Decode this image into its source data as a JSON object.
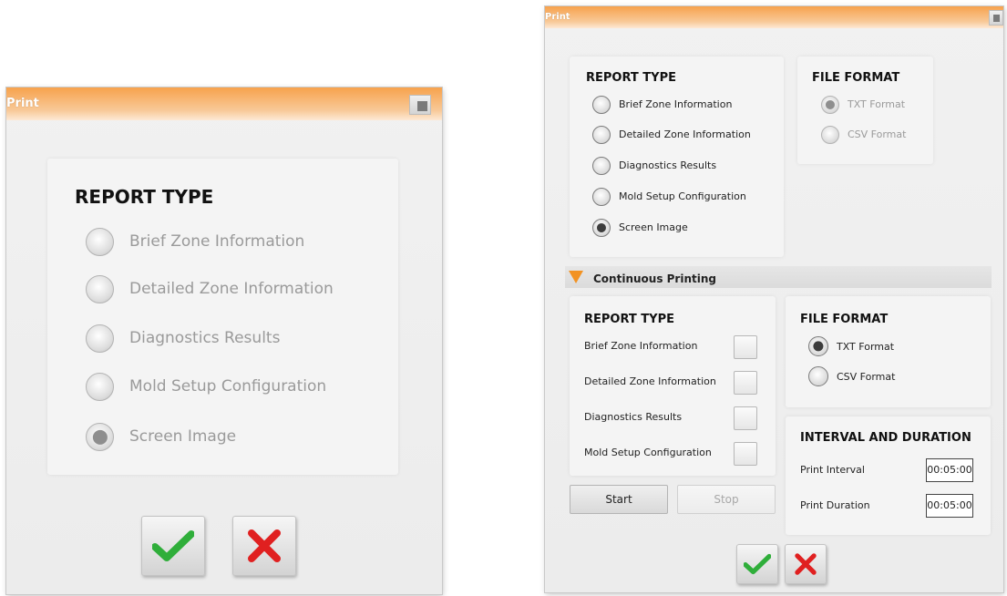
{
  "left_dialog": {
    "title": "Print",
    "report_type": {
      "heading": "REPORT TYPE",
      "options": [
        {
          "label": "Brief Zone Information",
          "selected": false
        },
        {
          "label": "Detailed Zone Information",
          "selected": false
        },
        {
          "label": "Diagnostics Results",
          "selected": false
        },
        {
          "label": "Mold Setup Configuration",
          "selected": false
        },
        {
          "label": "Screen Image",
          "selected": true
        }
      ]
    },
    "ok_icon": "checkmark-icon",
    "cancel_icon": "close-x-icon"
  },
  "right_dialog": {
    "title": "Print",
    "report_type": {
      "heading": "REPORT TYPE",
      "options": [
        {
          "label": "Brief Zone Information",
          "selected": false
        },
        {
          "label": "Detailed Zone Information",
          "selected": false
        },
        {
          "label": "Diagnostics Results",
          "selected": false
        },
        {
          "label": "Mold Setup Configuration",
          "selected": false
        },
        {
          "label": "Screen Image",
          "selected": true
        }
      ]
    },
    "file_format": {
      "heading": "FILE FORMAT",
      "options": [
        {
          "label": "TXT Format",
          "selected": true
        },
        {
          "label": "CSV Format",
          "selected": false
        }
      ]
    },
    "continuous_printing": {
      "label": "Continuous Printing",
      "report_type": {
        "heading": "REPORT TYPE",
        "items": [
          {
            "label": "Brief Zone Information",
            "checked": false
          },
          {
            "label": "Detailed Zone Information",
            "checked": false
          },
          {
            "label": "Diagnostics Results",
            "checked": false
          },
          {
            "label": "Mold Setup Configuration",
            "checked": false
          }
        ]
      },
      "file_format": {
        "heading": "FILE FORMAT",
        "options": [
          {
            "label": "TXT Format",
            "selected": true
          },
          {
            "label": "CSV Format",
            "selected": false
          }
        ]
      },
      "interval": {
        "heading": "INTERVAL AND DURATION",
        "print_interval_label": "Print Interval",
        "print_interval_value": "00:05:00",
        "print_duration_label": "Print Duration",
        "print_duration_value": "00:05:00"
      },
      "start_label": "Start",
      "stop_label": "Stop"
    },
    "ok_icon": "checkmark-icon",
    "cancel_icon": "close-x-icon"
  },
  "colors": {
    "title_orange": "#f7a24d",
    "check_green": "#2fae3a",
    "cancel_red": "#e02020"
  }
}
